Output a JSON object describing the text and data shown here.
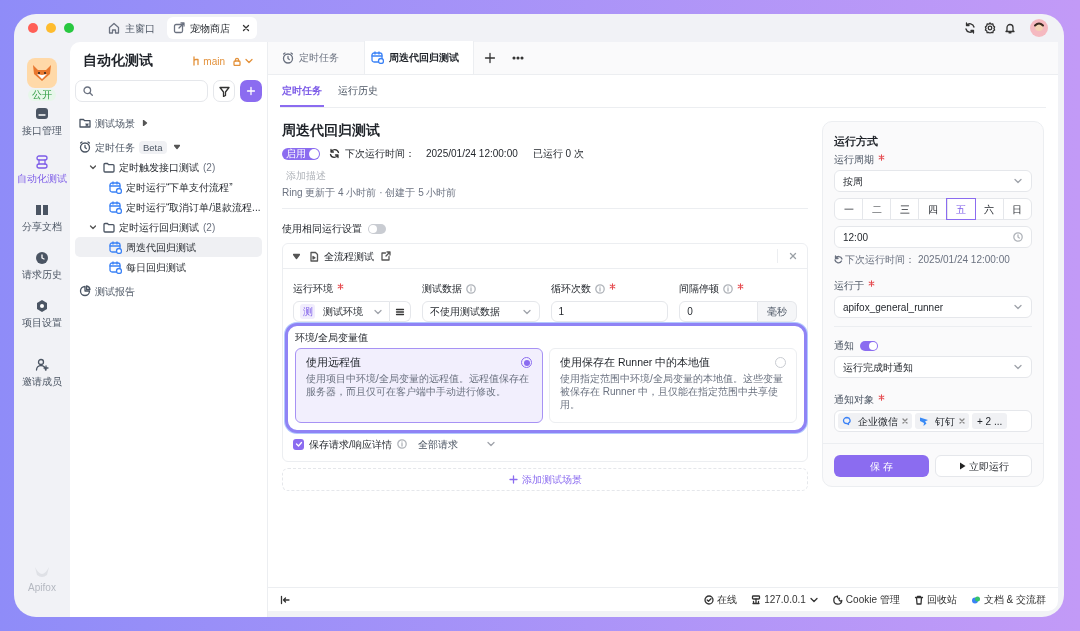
{
  "window_tabs": [
    {
      "label": "主窗口",
      "kind": "home",
      "selected": false
    },
    {
      "label": "宠物商店",
      "kind": "project",
      "selected": true
    }
  ],
  "nav": {
    "project_badge": "公开",
    "items": [
      {
        "label": "接口管理",
        "kind": "api",
        "selected": false
      },
      {
        "label": "自动化测试",
        "kind": "auto",
        "selected": true
      },
      {
        "label": "分享文档",
        "kind": "doc",
        "selected": false
      },
      {
        "label": "请求历史",
        "kind": "history",
        "selected": false
      },
      {
        "label": "项目设置",
        "kind": "settings",
        "selected": false
      },
      {
        "label": "邀请成员",
        "kind": "invite",
        "selected": false
      }
    ],
    "logo": "Apifox"
  },
  "sidebar": {
    "title": "自动化测试",
    "branch": "main",
    "tree": [
      {
        "label": "测试场景",
        "kind": "scenes",
        "expanded": false
      },
      {
        "label": "定时任务",
        "kind": "schedule",
        "badge": "Beta",
        "expanded": true,
        "children": [
          {
            "label": "定时触发接口测试",
            "count": "(2)",
            "kind": "folder",
            "expanded": true,
            "children": [
              {
                "label": "定时运行“下单支付流程”",
                "kind": "task",
                "selected": false
              },
              {
                "label": "定时运行“取消订单/退款流程...",
                "kind": "task",
                "selected": false
              }
            ]
          },
          {
            "label": "定时运行回归测试",
            "count": "(2)",
            "kind": "folder",
            "expanded": true,
            "children": [
              {
                "label": "周迭代回归测试",
                "kind": "task",
                "selected": true
              },
              {
                "label": "每日回归测试",
                "kind": "task",
                "selected": false
              }
            ]
          }
        ]
      },
      {
        "label": "测试报告",
        "kind": "report"
      }
    ]
  },
  "editor_tabs": [
    {
      "label": "定时任务",
      "kind": "clock",
      "selected": false
    },
    {
      "label": "周迭代回归测试",
      "kind": "task",
      "selected": true
    }
  ],
  "sub_tabs": [
    {
      "label": "定时任务",
      "selected": true
    },
    {
      "label": "运行历史",
      "selected": false
    }
  ],
  "task": {
    "title": "周迭代回归测试",
    "status_label": "启用",
    "enabled": true,
    "next_run_label": "下次运行时间：",
    "next_run": "2025/01/24 12:00:00",
    "run_count": "已运行 0 次",
    "description_placeholder": "添加描述",
    "meta": "Ring 更新于 4 小时前 · 创建于 5 小时前"
  },
  "same_settings": {
    "label": "使用相同运行设置",
    "on": false
  },
  "scenario": {
    "name": "全流程测试",
    "expanded": true,
    "fields": [
      {
        "label": "运行环境",
        "required": true,
        "info": false,
        "kind": "env",
        "badge": "测",
        "value": "测试环境"
      },
      {
        "label": "测试数据",
        "required": false,
        "info": true,
        "kind": "select",
        "value": "不使用测试数据"
      },
      {
        "label": "循环次数",
        "required": true,
        "info": true,
        "kind": "input",
        "value": "1"
      },
      {
        "label": "间隔停顿",
        "required": true,
        "info": true,
        "kind": "unit",
        "value": "0",
        "unit": "毫秒"
      }
    ],
    "save_details": {
      "label": "保存请求/响应详情",
      "checked": true,
      "value": "全部请求"
    }
  },
  "popup": {
    "title": "环境/全局变量值",
    "options": [
      {
        "title": "使用远程值",
        "description": "使用项目中环境/全局变量的远程值。远程值保存在服务器，而且仅可在客户端中手动进行修改。",
        "selected": true
      },
      {
        "title": "使用保存在 Runner 中的本地值",
        "description": "使用指定范围中环境/全局变量的本地值。这些变量被保存在 Runner 中，且仅能在指定范围中共享使用。",
        "selected": false
      }
    ]
  },
  "add_scenario": "添加测试场景",
  "run_panel": {
    "title": "运行方式",
    "period": {
      "label": "运行周期",
      "required": true,
      "value": "按周"
    },
    "weekdays": [
      {
        "label": "一",
        "selected": false
      },
      {
        "label": "二",
        "selected": false
      },
      {
        "label": "三",
        "selected": false
      },
      {
        "label": "四",
        "selected": false
      },
      {
        "label": "五",
        "selected": true
      },
      {
        "label": "六",
        "selected": false
      },
      {
        "label": "日",
        "selected": false
      }
    ],
    "time": "12:00",
    "next_run_label": "下次运行时间：",
    "next_run": "2025/01/24 12:00:00",
    "runner": {
      "label": "运行于",
      "required": true,
      "value": "apifox_general_runner"
    },
    "notify": {
      "label": "通知",
      "on": true,
      "value": "运行完成时通知"
    },
    "targets": {
      "label": "通知对象",
      "required": true,
      "tags": [
        {
          "label": "企业微信",
          "kind": "wecom"
        },
        {
          "label": "钉钉",
          "kind": "dingtalk"
        }
      ],
      "more": "+ 2 ..."
    },
    "buttons": [
      {
        "label": "保 存",
        "kind": "primary"
      },
      {
        "label": "立即运行",
        "kind": "run"
      }
    ]
  },
  "status_bar": [
    {
      "label": "在线",
      "kind": "online"
    },
    {
      "label": "127.0.0.1",
      "kind": "server"
    },
    {
      "label": "Cookie 管理",
      "kind": "cookie"
    },
    {
      "label": "回收站",
      "kind": "trash"
    },
    {
      "label": "文档 & 交流群",
      "kind": "community"
    }
  ]
}
